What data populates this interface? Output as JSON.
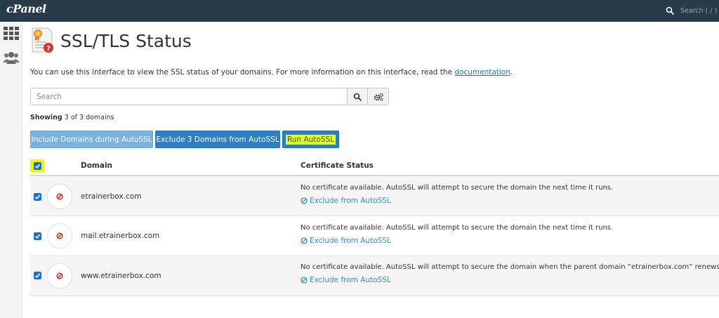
{
  "header": {
    "logo": "cPanel",
    "search_placeholder": "Search ( / )"
  },
  "page": {
    "title": "SSL/TLS Status",
    "intro_text": "You can use this interface to view the SSL status of your domains. For more information on this interface, read the ",
    "intro_link": "documentation",
    "intro_end": "."
  },
  "search": {
    "placeholder": "Search"
  },
  "showing": {
    "label": "Showing",
    "text": "3 of 3 domains"
  },
  "actions": {
    "include": "Include Domains during AutoSSL",
    "exclude": "Exclude 3 Domains from AutoSSL",
    "run": "Run AutoSSL"
  },
  "table": {
    "col_domain": "Domain",
    "col_status": "Certificate Status",
    "rows": [
      {
        "domain": "etrainerbox.com",
        "message": "No certificate available. AutoSSL will attempt to secure the domain the next time it runs.",
        "exclude_label": "Exclude from AutoSSL",
        "checked": true
      },
      {
        "domain": "mail.etrainerbox.com",
        "message": "No certificate available. AutoSSL will attempt to secure the domain the next time it runs.",
        "exclude_label": "Exclude from AutoSSL",
        "checked": true
      },
      {
        "domain": "www.etrainerbox.com",
        "message": "No certificate available. AutoSSL will attempt to secure the domain when the parent domain “etrainerbox.com” renews.",
        "exclude_label": "Exclude from AutoSSL",
        "checked": true
      }
    ]
  },
  "icons": {
    "top_search": "search-icon",
    "sidebar": [
      "grid-icon",
      "users-icon"
    ],
    "page": "certificate-icon",
    "search": "search-icon",
    "settings": "gears-icon",
    "status": "no-entry-icon",
    "exclude": "ban-icon",
    "checkbox": "checkmark-icon"
  },
  "colors": {
    "topbar": "#293a4a",
    "primary": "#2f7fc6",
    "primary_light": "#7ab3e0",
    "link": "#3b8ad8",
    "error": "#d9342b",
    "highlight": "#e4ff24"
  }
}
